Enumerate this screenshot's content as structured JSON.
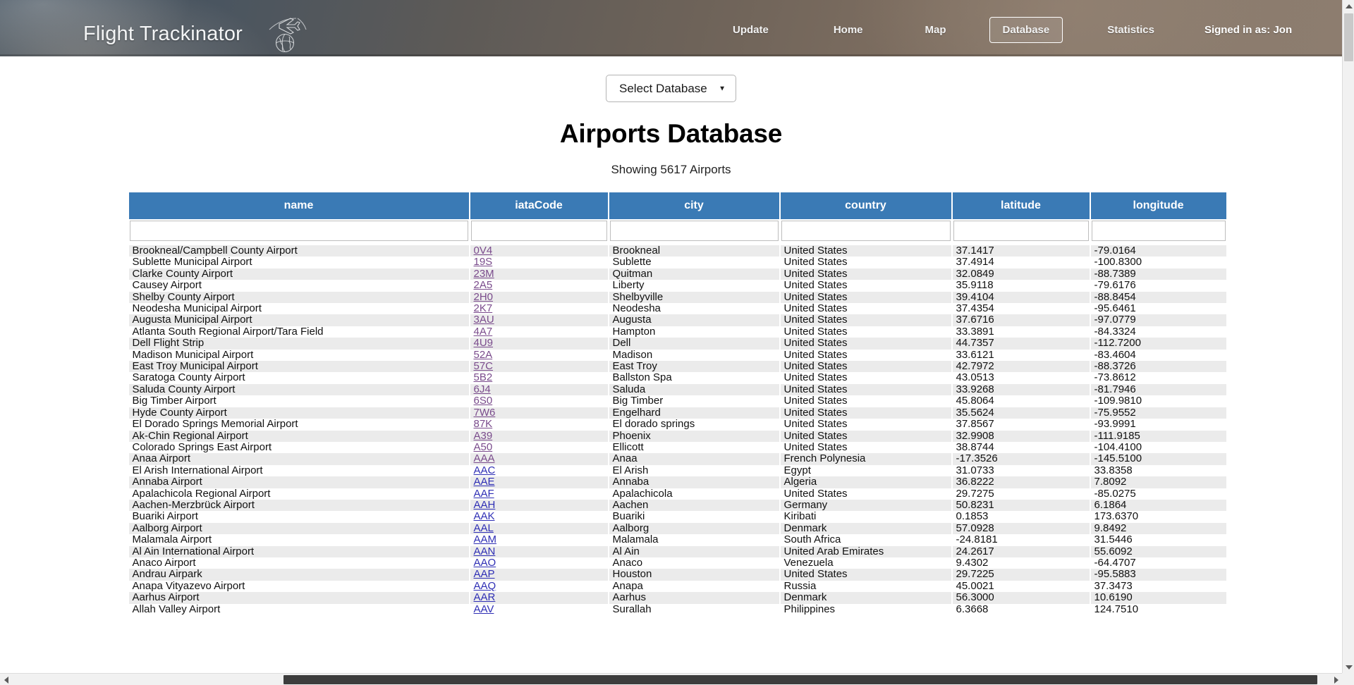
{
  "header": {
    "brand_title": "Flight Trackinator",
    "logo_icon": "airplane-globe-icon",
    "nav": [
      {
        "label": "Update",
        "active": false
      },
      {
        "label": "Home",
        "active": false
      },
      {
        "label": "Map",
        "active": false
      },
      {
        "label": "Database",
        "active": true
      },
      {
        "label": "Statistics",
        "active": false
      }
    ],
    "user_status": "Signed in as: Jon"
  },
  "toolbar": {
    "database_select_label": "Select Database",
    "dropdown_icon": "chevron-down-icon"
  },
  "main": {
    "title": "Airports Database",
    "subtitle": "Showing 5617 Airports",
    "columns": [
      "name",
      "iataCode",
      "city",
      "country",
      "latitude",
      "longitude"
    ],
    "filter_placeholders": [
      "",
      "",
      "",
      "",
      "",
      ""
    ],
    "filter_values": [
      "",
      "",
      "",
      "",
      "",
      ""
    ],
    "rows": [
      [
        "Brookneal/Campbell County Airport",
        "0V4",
        "Brookneal",
        "United States",
        "37.1417",
        "-79.0164"
      ],
      [
        "Sublette Municipal Airport",
        "19S",
        "Sublette",
        "United States",
        "37.4914",
        "-100.8300"
      ],
      [
        "Clarke County Airport",
        "23M",
        "Quitman",
        "United States",
        "32.0849",
        "-88.7389"
      ],
      [
        "Causey Airport",
        "2A5",
        "Liberty",
        "United States",
        "35.9118",
        "-79.6176"
      ],
      [
        "Shelby County Airport",
        "2H0",
        "Shelbyville",
        "United States",
        "39.4104",
        "-88.8454"
      ],
      [
        "Neodesha Municipal Airport",
        "2K7",
        "Neodesha",
        "United States",
        "37.4354",
        "-95.6461"
      ],
      [
        "Augusta Municipal Airport",
        "3AU",
        "Augusta",
        "United States",
        "37.6716",
        "-97.0779"
      ],
      [
        "Atlanta South Regional Airport/Tara Field",
        "4A7",
        "Hampton",
        "United States",
        "33.3891",
        "-84.3324"
      ],
      [
        "Dell Flight Strip",
        "4U9",
        "Dell",
        "United States",
        "44.7357",
        "-112.7200"
      ],
      [
        "Madison Municipal Airport",
        "52A",
        "Madison",
        "United States",
        "33.6121",
        "-83.4604"
      ],
      [
        "East Troy Municipal Airport",
        "57C",
        "East Troy",
        "United States",
        "42.7972",
        "-88.3726"
      ],
      [
        "Saratoga County Airport",
        "5B2",
        "Ballston Spa",
        "United States",
        "43.0513",
        "-73.8612"
      ],
      [
        "Saluda County Airport",
        "6J4",
        "Saluda",
        "United States",
        "33.9268",
        "-81.7946"
      ],
      [
        "Big Timber Airport",
        "6S0",
        "Big Timber",
        "United States",
        "45.8064",
        "-109.9810"
      ],
      [
        "Hyde County Airport",
        "7W6",
        "Engelhard",
        "United States",
        "35.5624",
        "-75.9552"
      ],
      [
        "El Dorado Springs Memorial Airport",
        "87K",
        "El dorado springs",
        "United States",
        "37.8567",
        "-93.9991"
      ],
      [
        "Ak-Chin Regional Airport",
        "A39",
        "Phoenix",
        "United States",
        "32.9908",
        "-111.9185"
      ],
      [
        "Colorado Springs East Airport",
        "A50",
        "Ellicott",
        "United States",
        "38.8744",
        "-104.4100"
      ],
      [
        "Anaa Airport",
        "AAA",
        "Anaa",
        "French Polynesia",
        "-17.3526",
        "-145.5100"
      ],
      [
        "El Arish International Airport",
        "AAC",
        "El Arish",
        "Egypt",
        "31.0733",
        "33.8358"
      ],
      [
        "Annaba Airport",
        "AAE",
        "Annaba",
        "Algeria",
        "36.8222",
        "7.8092"
      ],
      [
        "Apalachicola Regional Airport",
        "AAF",
        "Apalachicola",
        "United States",
        "29.7275",
        "-85.0275"
      ],
      [
        "Aachen-Merzbrück Airport",
        "AAH",
        "Aachen",
        "Germany",
        "50.8231",
        "6.1864"
      ],
      [
        "Buariki Airport",
        "AAK",
        "Buariki",
        "Kiribati",
        "0.1853",
        "173.6370"
      ],
      [
        "Aalborg Airport",
        "AAL",
        "Aalborg",
        "Denmark",
        "57.0928",
        "9.8492"
      ],
      [
        "Malamala Airport",
        "AAM",
        "Malamala",
        "South Africa",
        "-24.8181",
        "31.5446"
      ],
      [
        "Al Ain International Airport",
        "AAN",
        "Al Ain",
        "United Arab Emirates",
        "24.2617",
        "55.6092"
      ],
      [
        "Anaco Airport",
        "AAO",
        "Anaco",
        "Venezuela",
        "9.4302",
        "-64.4707"
      ],
      [
        "Andrau Airpark",
        "AAP",
        "Houston",
        "United States",
        "29.7225",
        "-95.5883"
      ],
      [
        "Anapa Vityazevo Airport",
        "AAQ",
        "Anapa",
        "Russia",
        "45.0021",
        "37.3473"
      ],
      [
        "Aarhus Airport",
        "AAR",
        "Aarhus",
        "Denmark",
        "56.3000",
        "10.6190"
      ],
      [
        "Allah Valley Airport",
        "AAV",
        "Surallah",
        "Philippines",
        "6.3668",
        "124.7510"
      ]
    ],
    "visited_links": [
      "0V4",
      "19S",
      "23M",
      "2A5",
      "2H0",
      "2K7",
      "3AU",
      "4A7",
      "4U9",
      "52A",
      "57C",
      "5B2",
      "6J4",
      "6S0",
      "7W6",
      "87K",
      "A39",
      "A50",
      "AAA"
    ]
  },
  "colors": {
    "header_blue": "#3a7ab5",
    "link_blue": "#2f2fb5",
    "link_visited": "#7a4b8c",
    "row_stripe": "#ebebeb",
    "nav_gradient_left": "#3e4e5c",
    "nav_gradient_right": "#8d7d6f"
  },
  "scrollbars": {
    "vertical_up_icon": "arrow-up-icon",
    "vertical_down_icon": "arrow-down-icon",
    "horizontal_left_icon": "arrow-left-icon",
    "horizontal_right_icon": "arrow-right-icon"
  }
}
